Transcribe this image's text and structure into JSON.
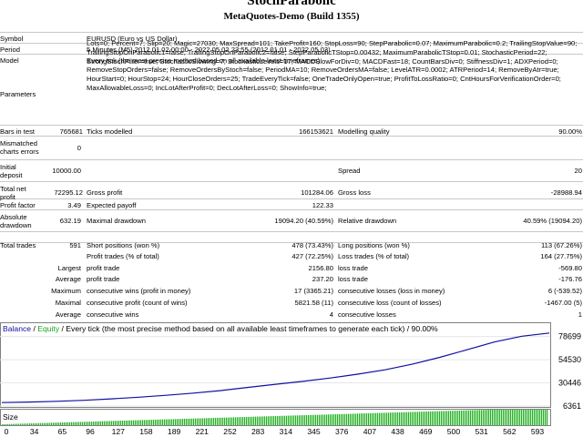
{
  "header": {
    "title": "StochParabolic",
    "server": "MetaQuotes-Demo (Build 1355)"
  },
  "report": {
    "symbol_label": "Symbol",
    "symbol": "EURUSD (Euro vs US Dollar)",
    "period_label": "Period",
    "period": "5 Minutes (M5) 2012.01.02 00:00 - 2022.05.02 23:55 (2012.01.01 - 2022.05.03)",
    "model_label": "Model",
    "model": "Every tick (the most precise method based on all available least timeframes)",
    "parameters_label": "Parameters",
    "parameters": "Lots=0; Percent=7; Slip=20; Magic=27030; MaxSpread=101; TakeProfit=160; StopLoss=90; StepParabolic=0.07; MaximumParabolic=0.2; TrailingStopValue=90; TrailingStopOnParabolic1=false; TrailingStopOnParabolic2=false; StepParabolicTStop=0.00432; MaximumParabolicTStop=0.01; StochasticPeriod=22; StrongStochFilter=true; StochasticSlowing=7; StochasticLevels=17; MACDSlowForDiv=0; MACDFast=18; CountBarsDiv=0; StiffnessDiv=1; ADXPeriod=0; RemoveStopOrders=false; RemoveOrdersByStoch=false; PeriodMA=10; RemoveOrdersMA=false; LevelATR=0.0002; ATRPeriod=14; RemoveByAtr=true; HourStart=0; HourStop=24; HourCloseOrders=25; TradeEveryTick=false; OneTradeOnlyOpen=true; ProfitToLossRatio=0; CntHoursForVerificationOrder=0; MaxAllowableLoss=0; IncLotAfterProfit=0; DecLotAfterLoss=0; ShowInfo=true;",
    "bars_label": "Bars in test",
    "bars": "765681",
    "ticks_label": "Ticks modelled",
    "ticks": "166153621",
    "quality_label": "Modelling quality",
    "quality": "90.00%",
    "mismatch_label1": "Mismatched",
    "mismatch_label2": "charts errors",
    "mismatch": "0",
    "deposit_label1": "Initial",
    "deposit_label2": "deposit",
    "deposit": "10000.00",
    "spread_label": "Spread",
    "spread": "20",
    "netprofit_label1": "Total net",
    "netprofit_label2": "profit",
    "netprofit": "72295.12",
    "grossprofit_label": "Gross profit",
    "grossprofit": "101284.06",
    "grossloss_label": "Gross loss",
    "grossloss": "-28988.94",
    "pf_label": "Profit factor",
    "pf": "3.49",
    "ep_label": "Expected payoff",
    "ep": "122.33",
    "absdd_label1": "Absolute",
    "absdd_label2": "drawdown",
    "absdd": "632.19",
    "maxdd_label": "Maximal drawdown",
    "maxdd": "19094.20 (40.59%)",
    "reldd_label": "Relative drawdown",
    "reldd": "40.59% (19094.20)",
    "trades_label": "Total trades",
    "trades": "591",
    "short_label": "Short positions (won %)",
    "short": "478 (73.43%)",
    "long_label": "Long positions (won %)",
    "long": "113 (67.26%)",
    "pt_label": "Profit trades (% of total)",
    "pt": "427 (72.25%)",
    "lt_label": "Loss trades (% of total)",
    "lt": "164 (27.75%)",
    "largest_label": "Largest",
    "lpt_label": "profit trade",
    "lpt": "2156.80",
    "llt_label": "loss trade",
    "llt": "-569.80",
    "average_label": "Average",
    "apt_label": "profit trade",
    "apt": "237.20",
    "alt_label": "loss trade",
    "alt": "-176.76",
    "maximum_label": "Maximum",
    "mcw_label": "consecutive wins (profit in money)",
    "mcw": "17 (3365.21)",
    "mcl_label": "consecutive losses (loss in money)",
    "mcl": "6 (-539.52)",
    "maximal_label": "Maximal",
    "mcp_label": "consecutive profit (count of wins)",
    "mcp": "5821.58 (11)",
    "mcll_label": "consecutive loss (count of losses)",
    "mcll": "-1467.00 (5)",
    "avg2_label": "Average",
    "acw_label": "consecutive wins",
    "acw": "4",
    "acl_label": "consecutive losses",
    "acl": "1"
  },
  "legend": {
    "balance": "Balance",
    "sep": "/",
    "equity": "Equity",
    "desc": "/ Every tick (the most precise method based on all available least timeframes to generate each tick) / 90.00%"
  },
  "colors": {
    "balance": "#1010a0",
    "equity": "#20a020",
    "size_bars": "#20b020"
  },
  "chart_data": {
    "type": "line",
    "series": [
      {
        "name": "Balance",
        "y": [
          10000,
          10500,
          11300,
          12300,
          13800,
          15500,
          17500,
          19800,
          22500,
          25800,
          29000,
          32000,
          35500,
          39500,
          44000,
          50000,
          57000,
          65000,
          73000,
          79000,
          82295
        ]
      }
    ],
    "y_ticks": [
      "78699",
      "54530",
      "30446",
      "6361"
    ],
    "y_range": [
      6361,
      84000
    ],
    "x_ticks": [
      "0",
      "34",
      "65",
      "96",
      "127",
      "158",
      "189",
      "221",
      "252",
      "283",
      "314",
      "345",
      "376",
      "407",
      "438",
      "469",
      "500",
      "531",
      "562",
      "593"
    ],
    "size_label": "Size"
  }
}
